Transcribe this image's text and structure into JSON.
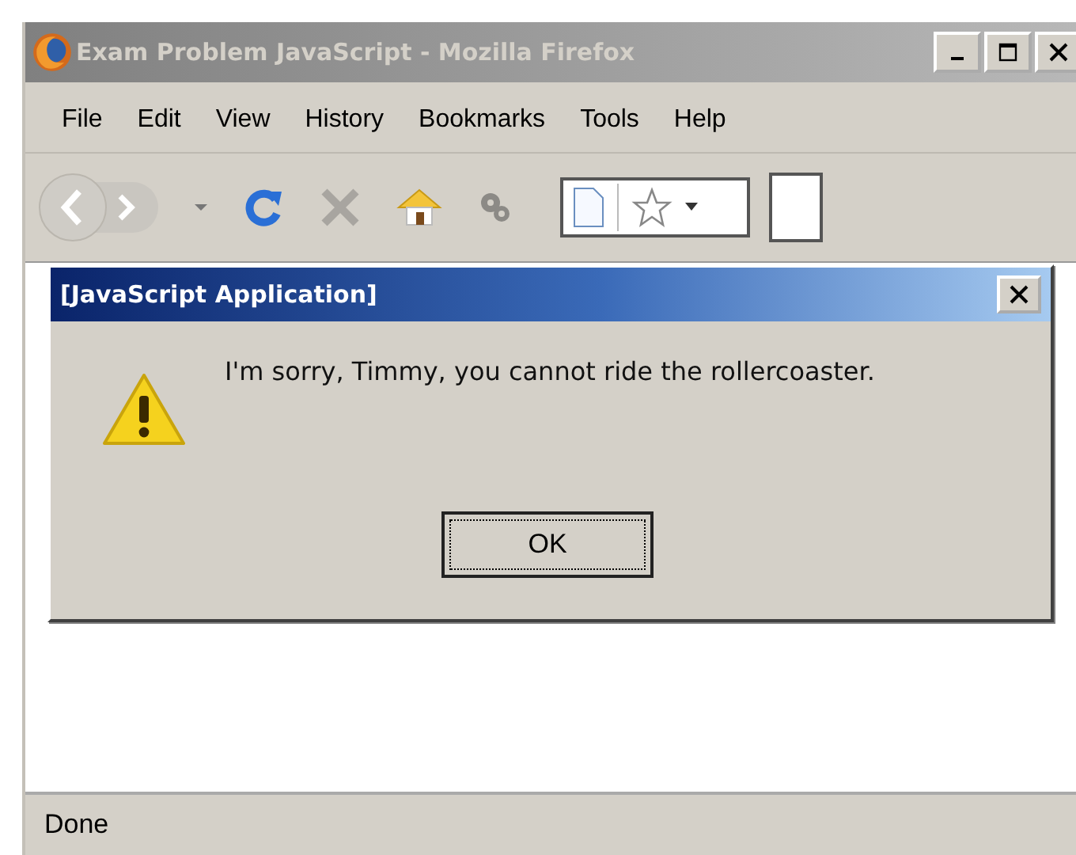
{
  "window": {
    "title": "Exam Problem JavaScript - Mozilla Firefox"
  },
  "menu": [
    {
      "label": "File"
    },
    {
      "label": "Edit"
    },
    {
      "label": "View"
    },
    {
      "label": "History"
    },
    {
      "label": "Bookmarks"
    },
    {
      "label": "Tools"
    },
    {
      "label": "Help"
    }
  ],
  "dialog": {
    "title": "[JavaScript Application]",
    "message": "I'm sorry, Timmy, you cannot ride the rollercoaster.",
    "button": "OK"
  },
  "status_bar": "Done"
}
